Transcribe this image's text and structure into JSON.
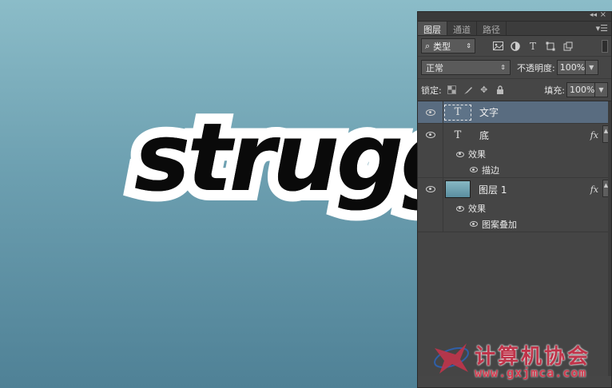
{
  "canvas": {
    "artwork_text": "struggl"
  },
  "panel": {
    "tabs": [
      {
        "label": "图层",
        "active": true
      },
      {
        "label": "通道",
        "active": false
      },
      {
        "label": "路径",
        "active": false
      }
    ],
    "filter": {
      "kind_label": "类型",
      "icons": [
        "pixel-filter-icon",
        "adjustment-filter-icon",
        "type-filter-icon",
        "shape-filter-icon",
        "smart-object-filter-icon"
      ]
    },
    "blend": {
      "mode": "正常",
      "opacity_label": "不透明度:",
      "opacity_value": "100%"
    },
    "lock": {
      "label": "锁定:",
      "fill_label": "填充:",
      "fill_value": "100%"
    },
    "layers": [
      {
        "name": "文字",
        "type": "text",
        "selected": true
      },
      {
        "name": "底",
        "type": "text",
        "has_fx": true,
        "fx_label": "fx",
        "effects_label": "效果",
        "effects": [
          "描边"
        ]
      },
      {
        "name": "图层 1",
        "type": "image",
        "has_fx": true,
        "fx_label": "fx",
        "effects_label": "效果",
        "effects": [
          "图案叠加"
        ]
      }
    ]
  },
  "watermark": {
    "title": "计算机协会",
    "url": "www.gxjmca.com",
    "colors": {
      "red": "#c0344a",
      "blue": "#2f5fa8"
    }
  }
}
